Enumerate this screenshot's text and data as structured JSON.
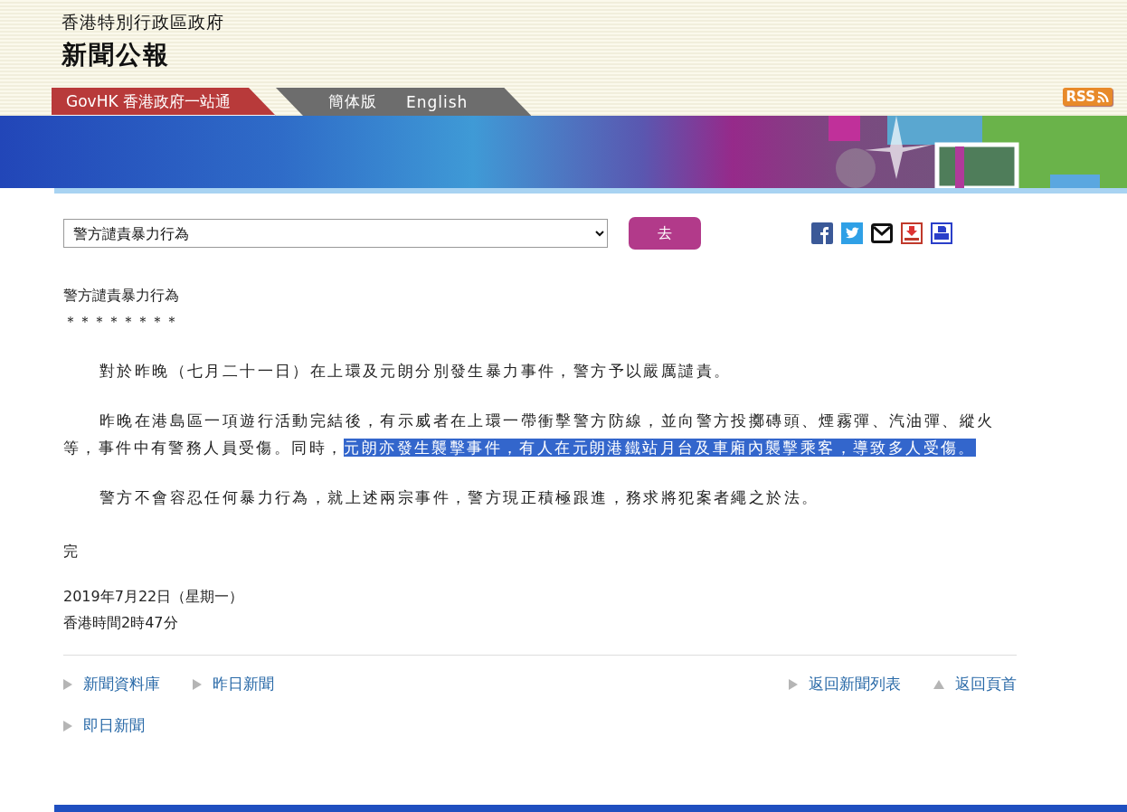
{
  "header": {
    "agency": "香港特別行政區政府",
    "title": "新聞公報"
  },
  "nav_tabs": [
    {
      "label": "GovHK 香港政府一站通",
      "kind": "portal"
    },
    {
      "label": "簡体版",
      "kind": "language"
    },
    {
      "label": "English",
      "kind": "language"
    }
  ],
  "rss": {
    "label": "RSS"
  },
  "article_select": {
    "value": "警方譴責暴力行為"
  },
  "go_button": {
    "label": "去"
  },
  "article": {
    "title": "警方譴責暴力行為",
    "separator": "＊＊＊＊＊＊＊＊",
    "paragraphs": [
      {
        "segments": [
          {
            "text": "對於昨晚（七月二十一日）在上環及元朗分別發生暴力事件，警方予以嚴厲譴責。",
            "selected": false
          }
        ]
      },
      {
        "segments": [
          {
            "text": "昨晚在港島區一項遊行活動完結後，有示威者在上環一帶衝擊警方防線，並向警方投擲磚頭、煙霧彈、汽油彈、縱火等，事件中有警務人員受傷。同時，",
            "selected": false
          },
          {
            "text": "元朗亦發生襲擊事件，有人在元朗港鐵站月台及車廂內襲擊乘客，導致多人受傷。",
            "selected": true
          }
        ]
      },
      {
        "segments": [
          {
            "text": "警方不會容忍任何暴力行為，就上述兩宗事件，警方現正積極跟進，務求將犯案者繩之於法。",
            "selected": false
          }
        ]
      }
    ],
    "end": "完",
    "date": "2019年7月22日（星期一）",
    "time": "香港時間2時47分"
  },
  "footer_rows": [
    {
      "left": [
        {
          "label": "新聞資料庫",
          "kind": "forward"
        },
        {
          "label": "昨日新聞",
          "kind": "forward"
        }
      ],
      "right": [
        {
          "label": "返回新聞列表",
          "kind": "forward"
        },
        {
          "label": "返回頁首",
          "kind": "top"
        }
      ]
    },
    {
      "left": [
        {
          "label": "即日新聞",
          "kind": "forward"
        }
      ],
      "right": []
    }
  ]
}
